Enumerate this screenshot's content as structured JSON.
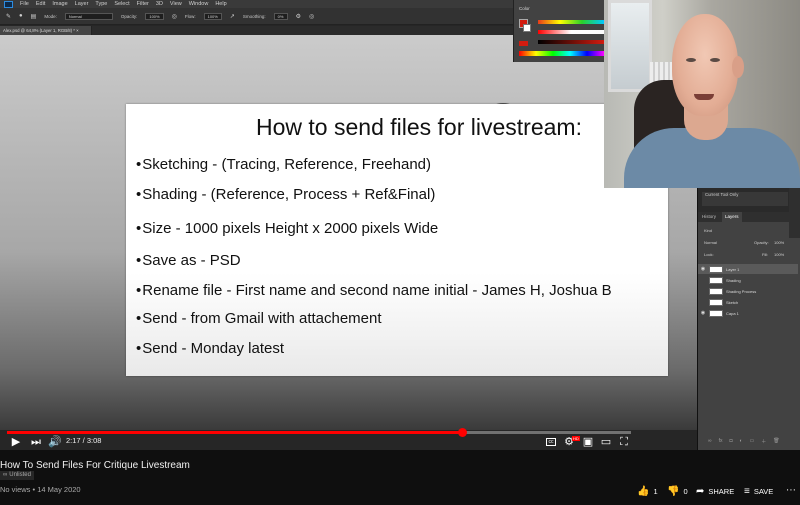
{
  "photoshop": {
    "menu": [
      "File",
      "Edit",
      "Image",
      "Layer",
      "Type",
      "Select",
      "Filter",
      "3D",
      "View",
      "Window",
      "Help"
    ],
    "options": {
      "mode_label": "Mode:",
      "mode_value": "Normal",
      "opacity_label": "Opacity:",
      "opacity_value": "100%",
      "flow_label": "Flow:",
      "flow_value": "100%",
      "smoothing_label": "Smoothing:",
      "smoothing_value": "0%"
    },
    "doc_tab": "Alex.psd @ 64,8% (Layer 1, RGB/8) * ×",
    "color_panel_title": "Color",
    "layers_panel": {
      "tabs": [
        "History",
        "Layers"
      ],
      "active_tab": "Layers",
      "current_tool_label": "Current Tool Only",
      "kind_label": "Kind",
      "blend_mode": "Normal",
      "opacity_label": "Opacity:",
      "opacity_value": "100%",
      "lock_label": "Lock:",
      "fill_label": "Fill:",
      "fill_value": "100%",
      "layers": [
        {
          "name": "Layer 1",
          "visible": true,
          "selected": true
        },
        {
          "name": "Shading",
          "visible": false,
          "selected": false
        },
        {
          "name": "Shading Process",
          "visible": false,
          "selected": false
        },
        {
          "name": "Sketch",
          "visible": false,
          "selected": false
        },
        {
          "name": "Capa 1",
          "visible": true,
          "selected": false
        }
      ]
    }
  },
  "slide": {
    "title": "How to send files for livestream:",
    "bullets": [
      "Sketching - (Tracing, Reference, Freehand)",
      "Shading - (Reference, Process + Ref&Final)",
      "Size - 1000 pixels Height x 2000 pixels Wide",
      "Save as - PSD",
      "Rename file - First name and second name initial - James H, Joshua B",
      "Send - from Gmail with attachement",
      "Send - Monday latest"
    ]
  },
  "player": {
    "current_time": "2:17",
    "duration": "3:08",
    "time_display": "2:17 / 3:08",
    "progress": 0.7287,
    "hd_badge": "HD"
  },
  "video": {
    "title": "How To Send Files For Critique Livestream",
    "visibility": "Unlisted",
    "views_date": "No views • 14 May 2020",
    "likes": "1",
    "dislikes": "0",
    "share_label": "SHARE",
    "save_label": "SAVE"
  },
  "colors": {
    "progress_red": "#ff0000",
    "like_blue": "#3ea6ff",
    "page_bg": "#0f0f0f",
    "foreground_swatch": "#d11c0f"
  }
}
